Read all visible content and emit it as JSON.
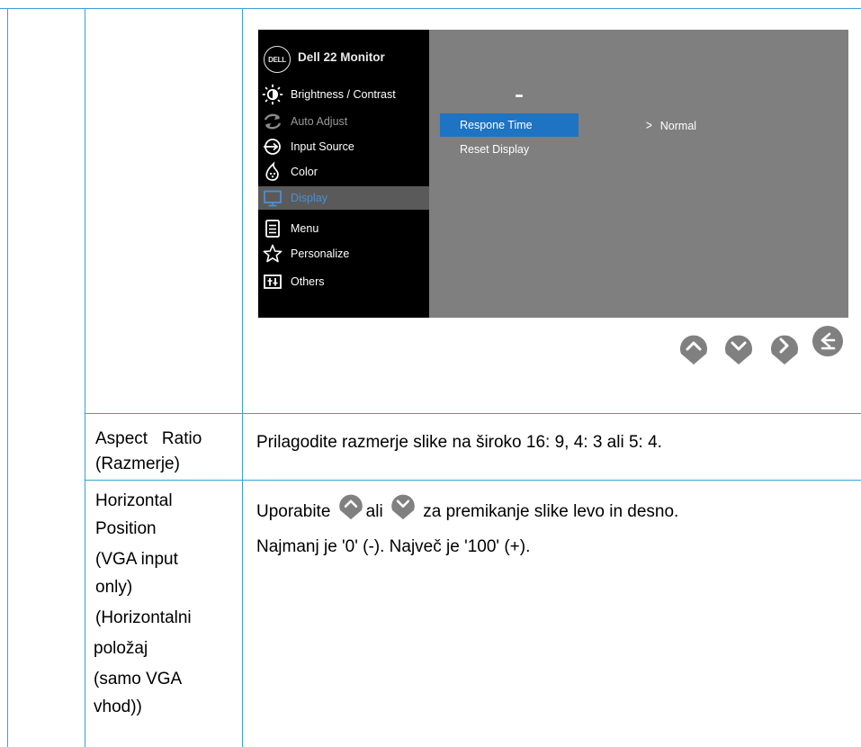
{
  "osd": {
    "logo": "DELL",
    "title": "Dell 22 Monitor",
    "menu": [
      {
        "label": "Brightness / Contrast",
        "icon": "brightness-icon",
        "state": "normal"
      },
      {
        "label": "Auto Adjust",
        "icon": "auto-adjust-icon",
        "state": "dim"
      },
      {
        "label": "Input Source",
        "icon": "input-source-icon",
        "state": "normal"
      },
      {
        "label": "Color",
        "icon": "color-icon",
        "state": "normal"
      },
      {
        "label": "Display",
        "icon": "display-icon",
        "state": "active"
      },
      {
        "label": "Menu",
        "icon": "menu-icon",
        "state": "normal"
      },
      {
        "label": "Personalize",
        "icon": "star-icon",
        "state": "normal"
      },
      {
        "label": "Others",
        "icon": "others-icon",
        "state": "normal"
      }
    ],
    "submenu": [
      {
        "label": "Respone Time",
        "selected": true
      },
      {
        "label": "Reset Display",
        "selected": false
      }
    ],
    "value": "Normal",
    "colors": {
      "accent": "#1f73c3",
      "active_text": "#4d8fd0",
      "panel": "#7f7f7f",
      "button": "#808080"
    }
  },
  "nav_buttons": [
    "up-arrow-icon",
    "down-arrow-icon",
    "right-arrow-icon",
    "back-icon"
  ],
  "rows": [
    {
      "label_lines": [
        "Aspect   Ratio",
        "(Razmerje)"
      ],
      "description": "Prilagodite razmerje slike na široko 16: 9, 4: 3 ali 5: 4."
    },
    {
      "label_lines": [
        "Horizontal",
        "Position",
        "(VGA input",
        "only)",
        "(Horizontalni",
        "položaj",
        "(samo VGA",
        "vhod))"
      ],
      "description_line1_before": "Uporabite",
      "description_line1_mid": "ali",
      "description_line1_after": "za premikanje slike levo in desno.",
      "description_line2": "Najmanj je '0' (-). Največ je '100' (+)."
    }
  ]
}
